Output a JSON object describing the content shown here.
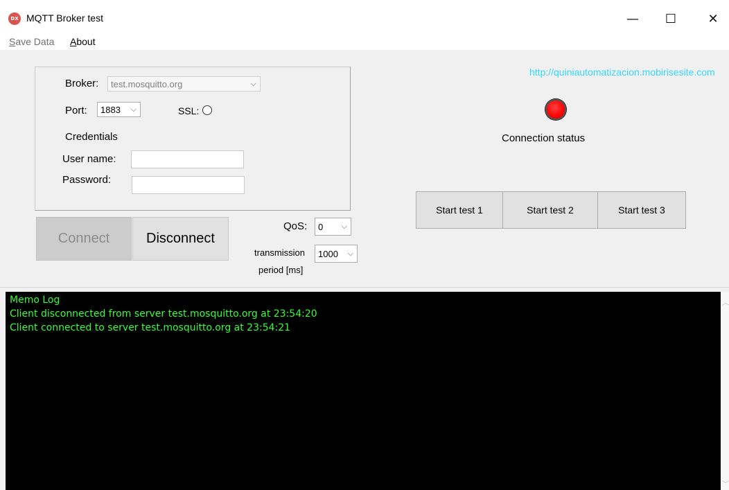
{
  "window": {
    "title": "MQTT Broker test",
    "icon": "dx-app-icon",
    "minimize": "—",
    "maximize": "☐",
    "close": "✕"
  },
  "menu": {
    "items": [
      {
        "label": "Save Data",
        "accel": "S",
        "rest": "ave Data"
      },
      {
        "label": "About",
        "accel": "A",
        "rest": "bout"
      }
    ]
  },
  "settings": {
    "broker_label": "Broker:",
    "broker_value": "test.mosquitto.org",
    "port_label": "Port:",
    "port_value": "1883",
    "ssl_label": "SSL:",
    "credentials_label": "Credentials",
    "username_label": "User name:",
    "username_value": "",
    "password_label": "Password:",
    "password_value": ""
  },
  "buttons": {
    "connect": "Connect",
    "disconnect": "Disconnect"
  },
  "qos": {
    "label": "QoS:",
    "value": "0"
  },
  "transmission": {
    "label_line1": "transmission",
    "label_line2": "period [ms]",
    "value": "1000"
  },
  "status": {
    "link": "http://quiniautomatizacion.mobirisesite.com",
    "label": "Connection status",
    "led_color": "#ff0000"
  },
  "tests": {
    "test1": "Start test 1",
    "test2": "Start test 2",
    "test3": "Start test 3"
  },
  "memo": {
    "lines": [
      "Memo Log",
      "Client disconnected from server test.mosquitto.org at 23:54:20",
      "Client connected to server test.mosquitto.org at 23:54:21"
    ],
    "text_color": "#33ff33"
  }
}
